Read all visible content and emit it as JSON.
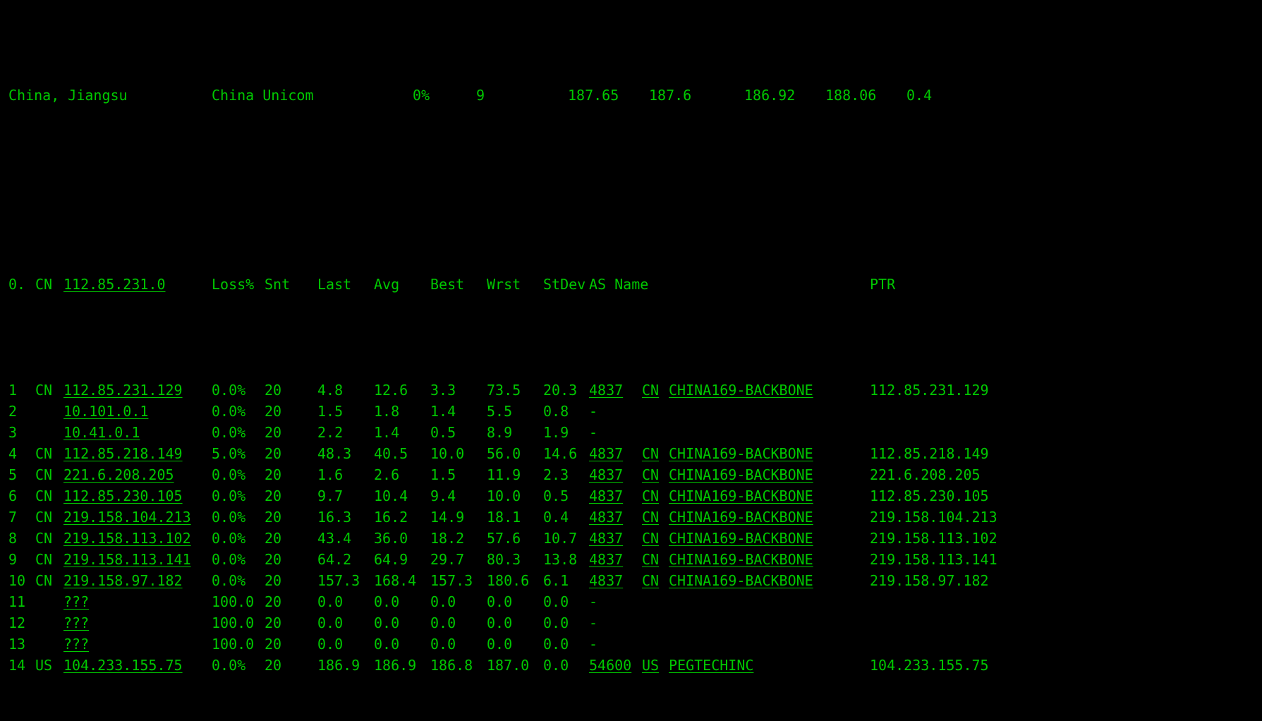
{
  "summary": {
    "location": "China, Jiangsu",
    "isp": "China Unicom",
    "v0": "0%",
    "v1": "9",
    "v2": "187.65",
    "v3": "187.6",
    "v4": "186.92",
    "v5": "188.06",
    "v6": "0.4"
  },
  "header": {
    "hop": "0.",
    "cc": "CN",
    "ip": "112.85.231.0",
    "loss": "Loss%",
    "snt": "Snt",
    "last": "Last",
    "avg": "Avg",
    "best": "Best",
    "wrst": "Wrst",
    "stdev": "StDev",
    "asname": "AS Name",
    "ptr": "PTR"
  },
  "hops": [
    {
      "hop": "1",
      "cc": "CN",
      "ip": "112.85.231.129",
      "loss": "0.0%",
      "snt": "20",
      "last": "4.8",
      "avg": "12.6",
      "best": "3.3",
      "wrst": "73.5",
      "stdev": "20.3",
      "asn": "4837",
      "asncc": "CN",
      "asname": "CHINA169-BACKBONE",
      "asdash": "",
      "ptr": "112.85.231.129"
    },
    {
      "hop": "2",
      "cc": "",
      "ip": "10.101.0.1",
      "loss": "0.0%",
      "snt": "20",
      "last": "1.5",
      "avg": "1.8",
      "best": "1.4",
      "wrst": "5.5",
      "stdev": "0.8",
      "asn": "",
      "asncc": "",
      "asname": "",
      "asdash": "-",
      "ptr": ""
    },
    {
      "hop": "3",
      "cc": "",
      "ip": "10.41.0.1",
      "loss": "0.0%",
      "snt": "20",
      "last": "2.2",
      "avg": "1.4",
      "best": "0.5",
      "wrst": "8.9",
      "stdev": "1.9",
      "asn": "",
      "asncc": "",
      "asname": "",
      "asdash": "-",
      "ptr": ""
    },
    {
      "hop": "4",
      "cc": "CN",
      "ip": "112.85.218.149",
      "loss": "5.0%",
      "snt": "20",
      "last": "48.3",
      "avg": "40.5",
      "best": "10.0",
      "wrst": "56.0",
      "stdev": "14.6",
      "asn": "4837",
      "asncc": "CN",
      "asname": "CHINA169-BACKBONE",
      "asdash": "",
      "ptr": "112.85.218.149"
    },
    {
      "hop": "5",
      "cc": "CN",
      "ip": "221.6.208.205",
      "loss": "0.0%",
      "snt": "20",
      "last": "1.6",
      "avg": "2.6",
      "best": "1.5",
      "wrst": "11.9",
      "stdev": "2.3",
      "asn": "4837",
      "asncc": "CN",
      "asname": "CHINA169-BACKBONE",
      "asdash": "",
      "ptr": "221.6.208.205"
    },
    {
      "hop": "6",
      "cc": "CN",
      "ip": "112.85.230.105",
      "loss": "0.0%",
      "snt": "20",
      "last": "9.7",
      "avg": "10.4",
      "best": "9.4",
      "wrst": "10.0",
      "stdev": "0.5",
      "asn": "4837",
      "asncc": "CN",
      "asname": "CHINA169-BACKBONE",
      "asdash": "",
      "ptr": "112.85.230.105"
    },
    {
      "hop": "7",
      "cc": "CN",
      "ip": "219.158.104.213",
      "loss": "0.0%",
      "snt": "20",
      "last": "16.3",
      "avg": "16.2",
      "best": "14.9",
      "wrst": "18.1",
      "stdev": "0.4",
      "asn": "4837",
      "asncc": "CN",
      "asname": "CHINA169-BACKBONE",
      "asdash": "",
      "ptr": "219.158.104.213"
    },
    {
      "hop": "8",
      "cc": "CN",
      "ip": "219.158.113.102",
      "loss": "0.0%",
      "snt": "20",
      "last": "43.4",
      "avg": "36.0",
      "best": "18.2",
      "wrst": "57.6",
      "stdev": "10.7",
      "asn": "4837",
      "asncc": "CN",
      "asname": "CHINA169-BACKBONE",
      "asdash": "",
      "ptr": "219.158.113.102"
    },
    {
      "hop": "9",
      "cc": "CN",
      "ip": "219.158.113.141",
      "loss": "0.0%",
      "snt": "20",
      "last": "64.2",
      "avg": "64.9",
      "best": "29.7",
      "wrst": "80.3",
      "stdev": "13.8",
      "asn": "4837",
      "asncc": "CN",
      "asname": "CHINA169-BACKBONE",
      "asdash": "",
      "ptr": "219.158.113.141"
    },
    {
      "hop": "10",
      "cc": "CN",
      "ip": "219.158.97.182",
      "loss": "0.0%",
      "snt": "20",
      "last": "157.3",
      "avg": "168.4",
      "best": "157.3",
      "wrst": "180.6",
      "stdev": "6.1",
      "asn": "4837",
      "asncc": "CN",
      "asname": "CHINA169-BACKBONE",
      "asdash": "",
      "ptr": "219.158.97.182"
    },
    {
      "hop": "11",
      "cc": "",
      "ip": "???",
      "loss": "100.0",
      "snt": "20",
      "last": "0.0",
      "avg": "0.0",
      "best": "0.0",
      "wrst": "0.0",
      "stdev": "0.0",
      "asn": "",
      "asncc": "",
      "asname": "",
      "asdash": "-",
      "ptr": ""
    },
    {
      "hop": "12",
      "cc": "",
      "ip": "???",
      "loss": "100.0",
      "snt": "20",
      "last": "0.0",
      "avg": "0.0",
      "best": "0.0",
      "wrst": "0.0",
      "stdev": "0.0",
      "asn": "",
      "asncc": "",
      "asname": "",
      "asdash": "-",
      "ptr": ""
    },
    {
      "hop": "13",
      "cc": "",
      "ip": "???",
      "loss": "100.0",
      "snt": "20",
      "last": "0.0",
      "avg": "0.0",
      "best": "0.0",
      "wrst": "0.0",
      "stdev": "0.0",
      "asn": "",
      "asncc": "",
      "asname": "",
      "asdash": "-",
      "ptr": ""
    },
    {
      "hop": "14",
      "cc": "US",
      "ip": "104.233.155.75",
      "loss": "0.0%",
      "snt": "20",
      "last": "186.9",
      "avg": "186.9",
      "best": "186.8",
      "wrst": "187.0",
      "stdev": "0.0",
      "asn": "54600",
      "asncc": "US",
      "asname": "PEGTECHINC",
      "asdash": "",
      "ptr": "104.233.155.75"
    }
  ]
}
